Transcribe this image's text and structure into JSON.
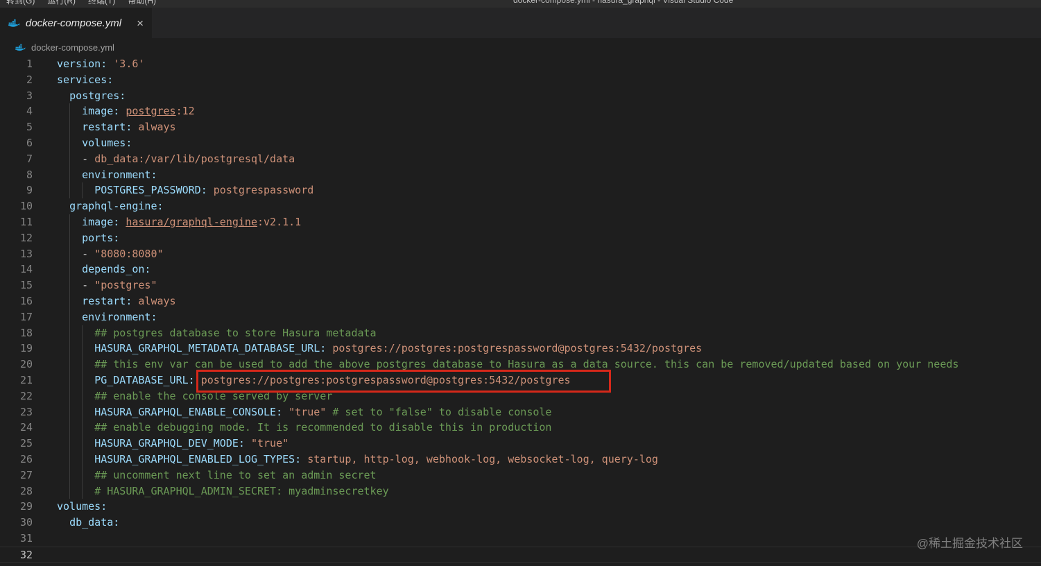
{
  "window": {
    "menu_items": [
      "转到(G)",
      "运行(R)",
      "终端(T)",
      "帮助(H)"
    ],
    "title": "docker-compose.yml - hasura_graphql - Visual Studio Code"
  },
  "tab": {
    "label": "docker-compose.yml",
    "close_glyph": "×"
  },
  "breadcrumb": {
    "file": "docker-compose.yml"
  },
  "watermark": "@稀土掘金技术社区",
  "colors": {
    "background": "#1e1e1e",
    "tab_strip": "#252526",
    "yaml_key": "#9cdcfe",
    "yaml_string": "#ce9178",
    "comment": "#6a9955",
    "plain_text": "#d4d4d4",
    "line_number": "#858585",
    "annotation_red": "#d6281a",
    "docker_icon_blue": "#1f9fda"
  },
  "editor": {
    "language": "yaml",
    "annotation": {
      "type": "red-highlight-box",
      "line": 21,
      "highlighted_text": "postgres://postgres:postgrespassword@postgres:5432/postgres"
    },
    "lines": [
      {
        "num": 1,
        "tokens": [
          {
            "t": "version:",
            "c": "key"
          },
          {
            "t": " ",
            "c": "pln"
          },
          {
            "t": "'3.6'",
            "c": "str"
          }
        ]
      },
      {
        "num": 2,
        "tokens": [
          {
            "t": "services:",
            "c": "key"
          }
        ]
      },
      {
        "num": 3,
        "tokens": [
          {
            "t": "  ",
            "c": "pln"
          },
          {
            "t": "postgres:",
            "c": "key"
          }
        ]
      },
      {
        "num": 4,
        "tokens": [
          {
            "t": "    ",
            "c": "pln"
          },
          {
            "t": "image:",
            "c": "key"
          },
          {
            "t": " ",
            "c": "pln"
          },
          {
            "t": "postgres",
            "c": "lnk"
          },
          {
            "t": ":12",
            "c": "str"
          }
        ]
      },
      {
        "num": 5,
        "tokens": [
          {
            "t": "    ",
            "c": "pln"
          },
          {
            "t": "restart:",
            "c": "key"
          },
          {
            "t": " ",
            "c": "pln"
          },
          {
            "t": "always",
            "c": "str"
          }
        ]
      },
      {
        "num": 6,
        "tokens": [
          {
            "t": "    ",
            "c": "pln"
          },
          {
            "t": "volumes:",
            "c": "key"
          }
        ]
      },
      {
        "num": 7,
        "tokens": [
          {
            "t": "    - ",
            "c": "pln"
          },
          {
            "t": "db_data:/var/lib/postgresql/data",
            "c": "str"
          }
        ]
      },
      {
        "num": 8,
        "tokens": [
          {
            "t": "    ",
            "c": "pln"
          },
          {
            "t": "environment:",
            "c": "key"
          }
        ]
      },
      {
        "num": 9,
        "tokens": [
          {
            "t": "      ",
            "c": "pln"
          },
          {
            "t": "POSTGRES_PASSWORD:",
            "c": "key"
          },
          {
            "t": " ",
            "c": "pln"
          },
          {
            "t": "postgrespassword",
            "c": "str"
          }
        ]
      },
      {
        "num": 10,
        "tokens": [
          {
            "t": "  ",
            "c": "pln"
          },
          {
            "t": "graphql-engine:",
            "c": "key"
          }
        ]
      },
      {
        "num": 11,
        "tokens": [
          {
            "t": "    ",
            "c": "pln"
          },
          {
            "t": "image:",
            "c": "key"
          },
          {
            "t": " ",
            "c": "pln"
          },
          {
            "t": "hasura/graphql-engine",
            "c": "lnk"
          },
          {
            "t": ":v2.1.1",
            "c": "str"
          }
        ]
      },
      {
        "num": 12,
        "tokens": [
          {
            "t": "    ",
            "c": "pln"
          },
          {
            "t": "ports:",
            "c": "key"
          }
        ]
      },
      {
        "num": 13,
        "tokens": [
          {
            "t": "    - ",
            "c": "pln"
          },
          {
            "t": "\"8080:8080\"",
            "c": "str"
          }
        ]
      },
      {
        "num": 14,
        "tokens": [
          {
            "t": "    ",
            "c": "pln"
          },
          {
            "t": "depends_on:",
            "c": "key"
          }
        ]
      },
      {
        "num": 15,
        "tokens": [
          {
            "t": "    - ",
            "c": "pln"
          },
          {
            "t": "\"postgres\"",
            "c": "str"
          }
        ]
      },
      {
        "num": 16,
        "tokens": [
          {
            "t": "    ",
            "c": "pln"
          },
          {
            "t": "restart:",
            "c": "key"
          },
          {
            "t": " ",
            "c": "pln"
          },
          {
            "t": "always",
            "c": "str"
          }
        ]
      },
      {
        "num": 17,
        "tokens": [
          {
            "t": "    ",
            "c": "pln"
          },
          {
            "t": "environment:",
            "c": "key"
          }
        ]
      },
      {
        "num": 18,
        "tokens": [
          {
            "t": "      ",
            "c": "pln"
          },
          {
            "t": "## postgres database to store Hasura metadata",
            "c": "cmt"
          }
        ]
      },
      {
        "num": 19,
        "tokens": [
          {
            "t": "      ",
            "c": "pln"
          },
          {
            "t": "HASURA_GRAPHQL_METADATA_DATABASE_URL:",
            "c": "key"
          },
          {
            "t": " ",
            "c": "pln"
          },
          {
            "t": "postgres://postgres:postgrespassword@postgres:5432/postgres",
            "c": "str"
          }
        ]
      },
      {
        "num": 20,
        "tokens": [
          {
            "t": "      ",
            "c": "pln"
          },
          {
            "t": "## this env var can be used to add the above postgres database to Hasura as a data source. this can be removed/updated based on your needs",
            "c": "cmt"
          }
        ]
      },
      {
        "num": 21,
        "tokens": [
          {
            "t": "      ",
            "c": "pln"
          },
          {
            "t": "PG_DATABASE_URL:",
            "c": "key"
          },
          {
            "t": " ",
            "c": "pln"
          },
          {
            "t": "postgres://postgres:postgrespassword@postgres:5432/postgres",
            "c": "str"
          }
        ]
      },
      {
        "num": 22,
        "tokens": [
          {
            "t": "      ",
            "c": "pln"
          },
          {
            "t": "## enable the console served by server",
            "c": "cmt"
          }
        ]
      },
      {
        "num": 23,
        "tokens": [
          {
            "t": "      ",
            "c": "pln"
          },
          {
            "t": "HASURA_GRAPHQL_ENABLE_CONSOLE:",
            "c": "key"
          },
          {
            "t": " ",
            "c": "pln"
          },
          {
            "t": "\"true\"",
            "c": "str"
          },
          {
            "t": " ",
            "c": "pln"
          },
          {
            "t": "# set to \"false\" to disable console",
            "c": "cmt"
          }
        ]
      },
      {
        "num": 24,
        "tokens": [
          {
            "t": "      ",
            "c": "pln"
          },
          {
            "t": "## enable debugging mode. It is recommended to disable this in production",
            "c": "cmt"
          }
        ]
      },
      {
        "num": 25,
        "tokens": [
          {
            "t": "      ",
            "c": "pln"
          },
          {
            "t": "HASURA_GRAPHQL_DEV_MODE:",
            "c": "key"
          },
          {
            "t": " ",
            "c": "pln"
          },
          {
            "t": "\"true\"",
            "c": "str"
          }
        ]
      },
      {
        "num": 26,
        "tokens": [
          {
            "t": "      ",
            "c": "pln"
          },
          {
            "t": "HASURA_GRAPHQL_ENABLED_LOG_TYPES:",
            "c": "key"
          },
          {
            "t": " ",
            "c": "pln"
          },
          {
            "t": "startup, http-log, webhook-log, websocket-log, query-log",
            "c": "str"
          }
        ]
      },
      {
        "num": 27,
        "tokens": [
          {
            "t": "      ",
            "c": "pln"
          },
          {
            "t": "## uncomment next line to set an admin secret",
            "c": "cmt"
          }
        ]
      },
      {
        "num": 28,
        "tokens": [
          {
            "t": "      ",
            "c": "pln"
          },
          {
            "t": "# HASURA_GRAPHQL_ADMIN_SECRET: myadminsecretkey",
            "c": "cmt"
          }
        ]
      },
      {
        "num": 29,
        "tokens": [
          {
            "t": "volumes:",
            "c": "key"
          }
        ]
      },
      {
        "num": 30,
        "tokens": [
          {
            "t": "  ",
            "c": "pln"
          },
          {
            "t": "db_data:",
            "c": "key"
          }
        ]
      },
      {
        "num": 31,
        "tokens": []
      },
      {
        "num": 32,
        "tokens": [],
        "current": true
      }
    ]
  }
}
